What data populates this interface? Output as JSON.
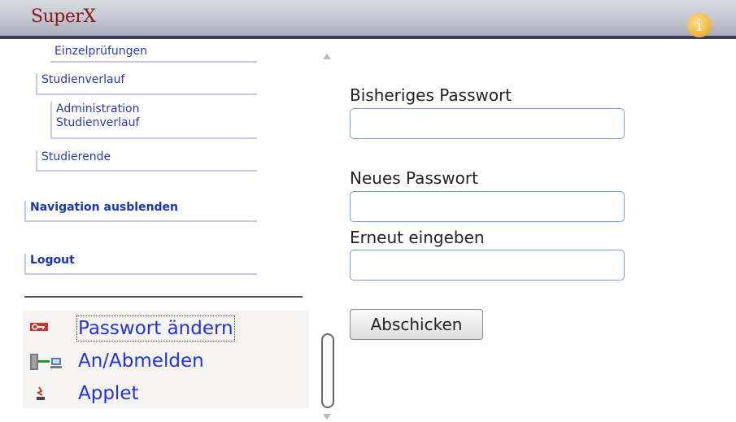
{
  "header": {
    "brand": "SuperX",
    "info_icon_glyph": "i"
  },
  "nav": {
    "items": [
      {
        "label": "Einzelprüfungen"
      },
      {
        "label": "Studienverlauf"
      },
      {
        "label": "Administration"
      },
      {
        "label": "Studienverlauf"
      },
      {
        "label": "Studierende"
      },
      {
        "label": "Navigation ausblenden"
      },
      {
        "label": "Logout"
      }
    ]
  },
  "tools": [
    {
      "label": "Passwort ändern",
      "icon": "key-icon"
    },
    {
      "label": "An/Abmelden",
      "icon": "network-icon"
    },
    {
      "label": "Applet",
      "icon": "java-applet-icon"
    }
  ],
  "form": {
    "old_password_label": "Bisheriges Passwort",
    "old_password_value": "",
    "new_password_label": "Neues Passwort",
    "new_password_value": "",
    "repeat_password_label": "Erneut eingeben",
    "repeat_password_value": "",
    "submit_label": "Abschicken"
  }
}
